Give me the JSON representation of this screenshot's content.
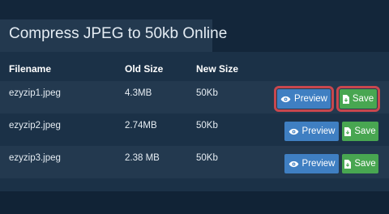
{
  "title": "Compress JPEG to 50kb Online",
  "table": {
    "headers": {
      "filename": "Filename",
      "old_size": "Old Size",
      "new_size": "New Size"
    },
    "rows": [
      {
        "filename": "ezyzip1.jpeg",
        "old_size": "4.3MB",
        "new_size": "50Kb",
        "preview_label": "Preview",
        "save_label": "Save"
      },
      {
        "filename": "ezyzip2.jpeg",
        "old_size": "2.74MB",
        "new_size": "50Kb",
        "preview_label": "Preview",
        "save_label": "Save"
      },
      {
        "filename": "ezyzip3.jpeg",
        "old_size": "2.38 MB",
        "new_size": "50Kb",
        "preview_label": "Preview",
        "save_label": "Save"
      }
    ]
  },
  "icons": {
    "preview": "eye-icon",
    "save": "file-download-icon"
  },
  "colors": {
    "preview_button": "#3f7fc2",
    "save_button": "#48a651",
    "highlight": "#c8474e"
  }
}
